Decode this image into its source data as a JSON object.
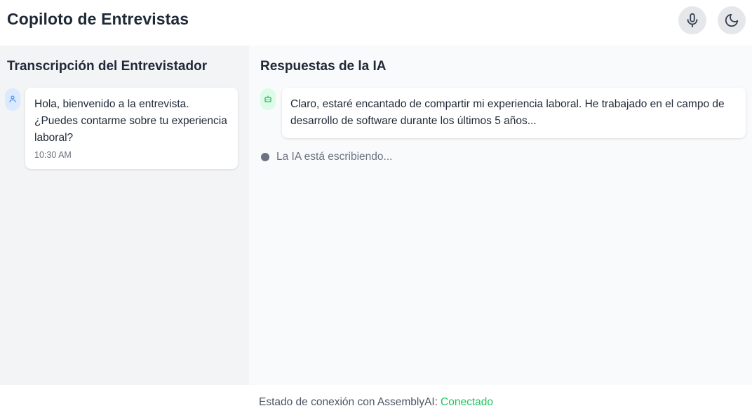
{
  "header": {
    "title": "Copiloto de Entrevistas",
    "mic_icon": "microphone-icon",
    "theme_icon": "moon-icon"
  },
  "interviewer_panel": {
    "title": "Transcripción del Entrevistador",
    "messages": [
      {
        "avatar_icon": "user-icon",
        "text": "Hola, bienvenido a la entrevista. ¿Puedes contarme sobre tu experiencia laboral?",
        "time": "10:30 AM"
      }
    ]
  },
  "ai_panel": {
    "title": "Respuestas de la IA",
    "messages": [
      {
        "avatar_icon": "bot-icon",
        "text": "Claro, estaré encantado de compartir mi experiencia laboral. He trabajado en el campo de desarrollo de software durante los últimos 5 años..."
      }
    ],
    "typing_text": "La IA está escribiendo..."
  },
  "footer": {
    "status_label": "Estado de conexión con AssemblyAI:",
    "status_value": "Conectado"
  },
  "colors": {
    "status_ok": "#22c55e",
    "user_avatar_bg": "#dbeafe",
    "bot_avatar_bg": "#dcfce7",
    "left_panel_bg": "#f3f4f6",
    "right_panel_bg": "#f9fafb"
  }
}
